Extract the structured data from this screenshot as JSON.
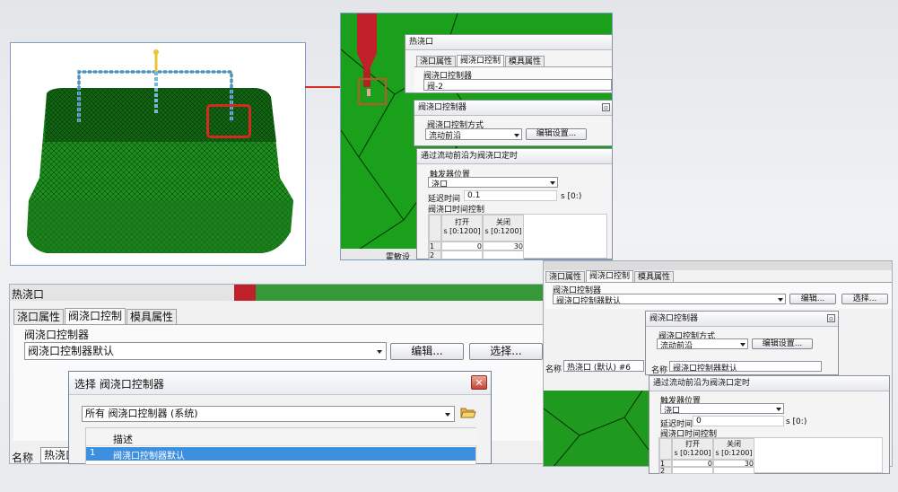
{
  "tl": {},
  "tm": {
    "title": "热浇口",
    "tabs": [
      "浇口属性",
      "阀浇口控制",
      "模具属性"
    ],
    "ctrl_label": "阀浇口控制器",
    "ctrl_value": "阀-2",
    "sub_title": "阀浇口控制器",
    "method_label": "阀浇口控制方式",
    "method_value": "流动前沿",
    "edit_settings": "编辑设置...",
    "front_title": "通过流动前沿为阀浇口定时",
    "trigger_label": "触发器位置",
    "trigger_value": "浇口",
    "delay_label": "延迟时间",
    "delay_value": "0.1",
    "delay_unit": "s [0:)",
    "timing_label": "阀浇口时间控制",
    "col_open": "打开",
    "col_close": "关闭",
    "col_unit": "s [0:1200]",
    "rows": [
      {
        "n": "1",
        "open": "0",
        "close": "30"
      },
      {
        "n": "2",
        "open": "",
        "close": ""
      }
    ],
    "bottom_text": "霍敏设"
  },
  "bl": {
    "title": "热浇口",
    "tabs": [
      "浇口属性",
      "阀浇口控制",
      "模具属性"
    ],
    "ctrl_label": "阀浇口控制器",
    "ctrl_value": "阀浇口控制器默认",
    "edit_btn": "编辑...",
    "select_btn": "选择...",
    "name_label": "名称",
    "name_value": "热浇口",
    "sel_dialog": {
      "title": "选择 阀浇口控制器",
      "filter": "所有 阀浇口控制器 (系统)",
      "col_desc": "描述",
      "row_num": "1",
      "row_desc": "阀浇口控制器默认"
    }
  },
  "br": {
    "tabs": [
      "浇口属性",
      "阀浇口控制",
      "模具属性"
    ],
    "ctrl_label": "阀浇口控制器",
    "ctrl_value": "阀浇口控制器默认",
    "edit_btn": "编辑...",
    "select_btn": "选择...",
    "name_label": "名称",
    "name_value": "热浇口 (默认) #6",
    "d2_title": "阀浇口控制器",
    "method_label": "阀浇口控制方式",
    "method_value": "流动前沿",
    "edit_settings": "编辑设置...",
    "d2_name_label": "名称",
    "d2_name_value": "阀浇口控制器默认",
    "front_title": "通过流动前沿为阀浇口定时",
    "trigger_label": "触发器位置",
    "trigger_value": "浇口",
    "delay_label": "延迟时间",
    "delay_value": "0",
    "delay_unit": "s [0:)",
    "timing_label": "阀浇口时间控制",
    "col_open": "打开",
    "col_close": "关闭",
    "col_unit": "s [0:1200]",
    "rows": [
      {
        "n": "1",
        "open": "0",
        "close": "30"
      },
      {
        "n": "2",
        "open": "",
        "close": ""
      }
    ]
  }
}
